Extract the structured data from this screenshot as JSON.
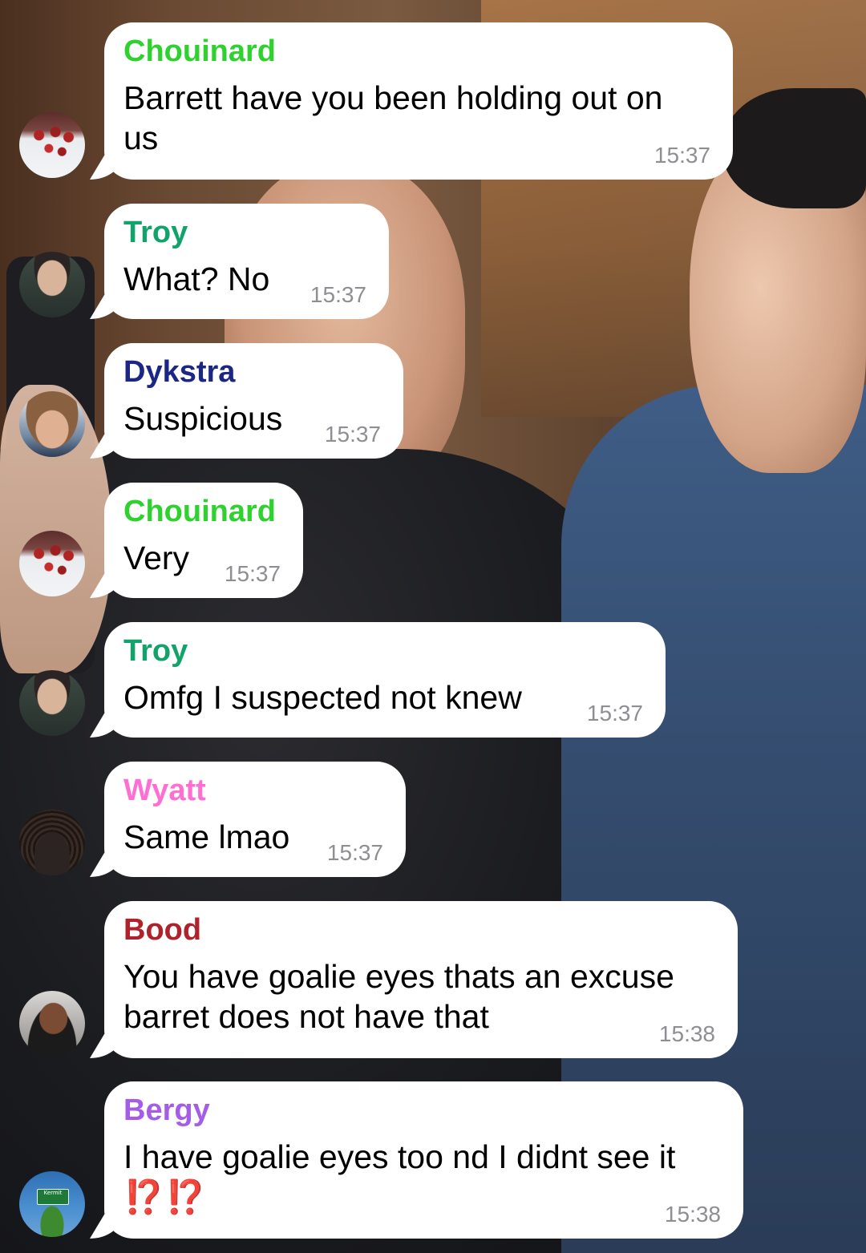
{
  "colors": {
    "bubble_bg": "#ffffff",
    "message_text": "#000000",
    "timestamp": "#8e8e93",
    "sender_chouinard": "#2fd12f",
    "sender_troy": "#11a36a",
    "sender_dykstra": "#1c2685",
    "sender_wyatt": "#ff6fd1",
    "sender_bood": "#b0222b",
    "sender_bergy": "#a55ce6",
    "exclamation": "#e0301e"
  },
  "messages": [
    {
      "sender": "Chouinard",
      "avatar": "hockey-team-avatar",
      "text_line1": "Barrett have you been holding out on",
      "text_line2": "us",
      "time": "15:37"
    },
    {
      "sender": "Troy",
      "avatar": "young-man-avatar",
      "text": "What? No",
      "time": "15:37"
    },
    {
      "sender": "Dykstra",
      "avatar": "cowboy-hat-avatar",
      "text": "Suspicious",
      "time": "15:37"
    },
    {
      "sender": "Chouinard",
      "avatar": "hockey-team-avatar",
      "text": "Very",
      "time": "15:37"
    },
    {
      "sender": "Troy",
      "avatar": "young-man-avatar",
      "text": "Omfg I suspected not knew",
      "time": "15:37"
    },
    {
      "sender": "Wyatt",
      "avatar": "curly-hair-avatar",
      "text": "Same lmao",
      "time": "15:37"
    },
    {
      "sender": "Bood",
      "avatar": "selfie-avatar",
      "text_line1": "You have goalie eyes thats an excuse",
      "text_line2": "barret does not have that",
      "time": "15:38"
    },
    {
      "sender": "Bergy",
      "avatar": "kermit-sign-avatar",
      "text_line1": "I have goalie eyes too nd I didnt see it",
      "text_line2": "⁉️⁉️",
      "time": "15:38",
      "avatar_sign_text": "Kermit"
    }
  ]
}
